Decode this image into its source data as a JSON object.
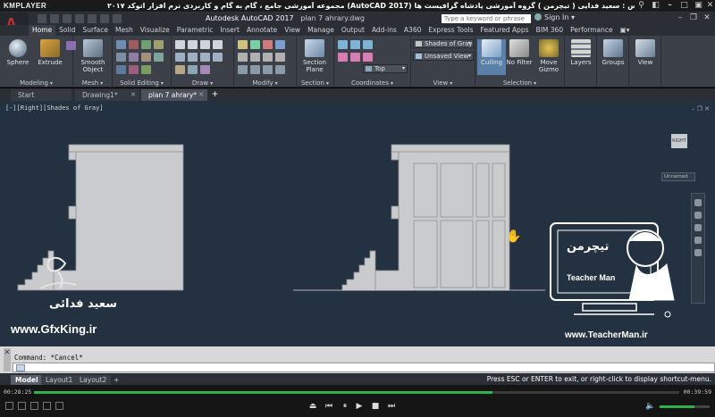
{
  "player": {
    "logo": "KMPLAYER",
    "title": "مجموعه آموزشی جامع ، گام به گام و کاربردی نرم افزار اتوکد ۲۰۱۷ (AutoCAD 2017) مدرس : سعید فدایی ( تیچرمن ) گروه آموزشی پادشاه گرافیست ها",
    "time_elapsed": "00:28:25",
    "time_total": "00:39:59",
    "progress": 0.711,
    "volume": 0.7
  },
  "app": {
    "logo_letter": "A",
    "title_prefix": "Autodesk AutoCAD 2017",
    "title_file": "plan 7 ahrary.dwg",
    "search_placeholder": "Type a keyword or phrase",
    "signin": "Sign In"
  },
  "ribbon_tabs": [
    "Home",
    "Solid",
    "Surface",
    "Mesh",
    "Visualize",
    "Parametric",
    "Insert",
    "Annotate",
    "View",
    "Manage",
    "Output",
    "Add-ins",
    "A360",
    "Express Tools",
    "Featured Apps",
    "BIM 360",
    "Performance"
  ],
  "ribbon": {
    "groups": [
      "Modeling",
      "Mesh",
      "Solid Editing",
      "Draw",
      "Modify",
      "Section",
      "Coordinates",
      "View",
      "Selection"
    ],
    "buttons": {
      "sphere": "Sphere",
      "extrude": "Extrude",
      "smooth_object": "Smooth Object",
      "section_plane": "Section Plane",
      "culling": "Culling",
      "no_filter": "No Filter",
      "move_gizmo": "Move Gizmo",
      "layers": "Layers",
      "groups": "Groups",
      "view": "View"
    },
    "visual_style": "Shades of Gray",
    "saved_view": "Unsaved View",
    "ucs": "Top"
  },
  "doc_tabs": [
    "Start",
    "Drawing1*",
    "plan 7 ahrary*"
  ],
  "viewport": {
    "label": "[-][Right][Shades of Gray]",
    "viewcube": "RIGHT",
    "named_view": "Unnamed"
  },
  "watermarks": {
    "left_name": "سعید فدائی",
    "left_url": "www.GfxKing.ir",
    "right_brand": "تیچرمن",
    "right_brand_en": "Teacher Man",
    "right_url": "www.TeacherMan.ir"
  },
  "command": {
    "history": "Command: *Cancel*",
    "input_value": ""
  },
  "layout_tabs": [
    "Model",
    "Layout1",
    "Layout2"
  ],
  "status_message": "Press ESC or ENTER to exit, or right-click to display shortcut-menu.",
  "colors": {
    "viewport_bg": "#233140",
    "progress_green": "#2fb24c",
    "autocad_red": "#c9312c"
  }
}
